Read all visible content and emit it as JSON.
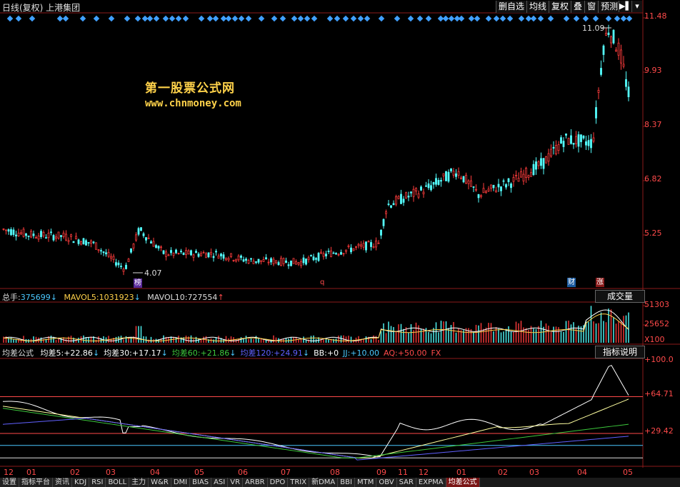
{
  "header": {
    "title": "日线(复权)  上港集团",
    "buttons": [
      "删自选",
      "均线",
      "复权",
      "叠",
      "窗",
      "预测"
    ],
    "nav_arrow": "▶▌",
    "nav_down": "▾"
  },
  "watermark": {
    "line1": "第一股票公式网",
    "line2": "www.chnmoney.com"
  },
  "price_axis": [
    "11.48",
    "9.93",
    "8.37",
    "6.82",
    "5.25"
  ],
  "annotations": {
    "high": "11.09",
    "low": "4.07",
    "tag_bang": "榜",
    "tag_q": "q",
    "tag_cai": "财",
    "tag_zhang": "涨"
  },
  "volume": {
    "label_total": "总手:",
    "total": "375699",
    "label_mavol5": "MAVOL5:",
    "mavol5": "1031923",
    "label_mavol10": "MAVOL10:",
    "mavol10": "727554",
    "panel_button": "成交量",
    "axis": [
      "51303",
      "25652",
      "X100"
    ]
  },
  "indicator": {
    "name": "均差公式",
    "labels": [
      {
        "text": "均差5:",
        "value": "+22.86",
        "color": "#ffffff"
      },
      {
        "text": "均差30:",
        "value": "+17.17",
        "color": "#ffffff"
      },
      {
        "text": "均差60:",
        "value": "+21.86",
        "color": "#3cc83c"
      },
      {
        "text": "均差120:",
        "value": "+24.91",
        "color": "#6060ff"
      },
      {
        "text": "BB:",
        "value": "+0",
        "color": "#ffffff"
      },
      {
        "text": "JJ:",
        "value": "+10.00",
        "color": "#4ac8ff"
      },
      {
        "text": "AQ:",
        "value": "+50.00",
        "color": "#ff4a4a"
      },
      {
        "text": "FX",
        "value": "",
        "color": "#ff4a4a"
      }
    ],
    "panel_button": "指标说明",
    "axis": [
      "+100.0",
      "+64.71",
      "+29.42"
    ]
  },
  "time_axis": [
    "12",
    "01",
    "02",
    "03",
    "04",
    "05",
    "06",
    "07",
    "08",
    "09",
    "11",
    "12",
    "01",
    "02",
    "03",
    "04",
    "05"
  ],
  "tabs": [
    "设置",
    "指标平台",
    "资讯",
    "KDJ",
    "RSI",
    "BOLL",
    "主力",
    "W&R",
    "DMI",
    "BIAS",
    "ASI",
    "VR",
    "ARBR",
    "DPO",
    "TRIX",
    "新DMA",
    "BBI",
    "MTM",
    "OBV",
    "SAR",
    "EXPMA",
    "均差公式"
  ],
  "active_tab": "均差公式",
  "colors": {
    "up": "#ff3c3c",
    "down": "#54ffff",
    "grid": "#8b1a1a",
    "diamond": "#40a0ff"
  },
  "chart_data": {
    "type": "candlestick",
    "price_range": [
      4.07,
      11.09
    ],
    "volume_range": [
      0,
      51303
    ],
    "indicator_range": [
      0,
      100
    ],
    "indicator_reference_lines": [
      64.71,
      29.42
    ]
  }
}
